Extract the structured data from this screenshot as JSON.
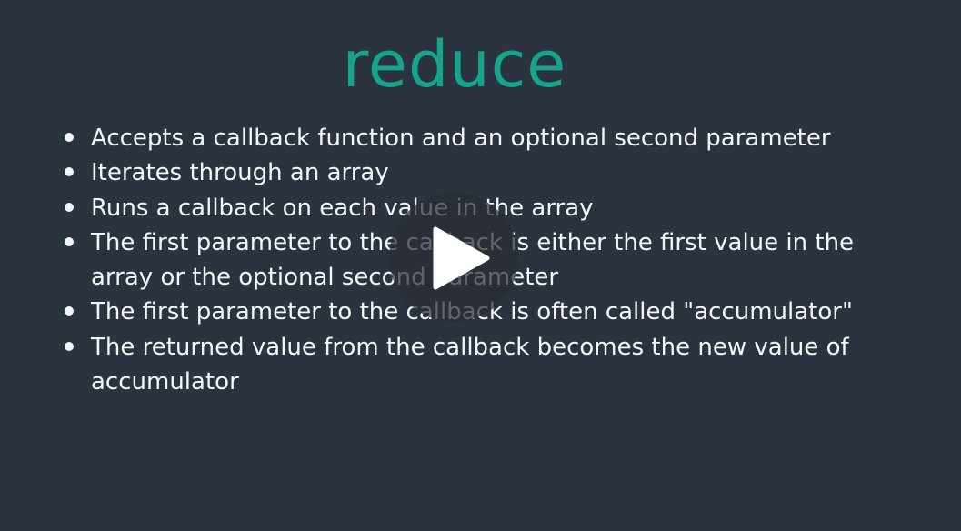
{
  "slide": {
    "title": "reduce",
    "bullets": [
      "Accepts a callback function and an optional second parameter",
      "Iterates through an array",
      "Runs a callback on each value in the array",
      "The first parameter to the callback is either the first value in the array or the optional second parameter",
      "The first parameter to the callback is often called \"accumulator\"",
      "The returned value from the callback becomes the new value of accumulator"
    ]
  },
  "player": {
    "play_icon": "play-icon",
    "colors": {
      "background": "#2b333e",
      "title": "#15a58c",
      "text": "#f4f5f6"
    }
  }
}
